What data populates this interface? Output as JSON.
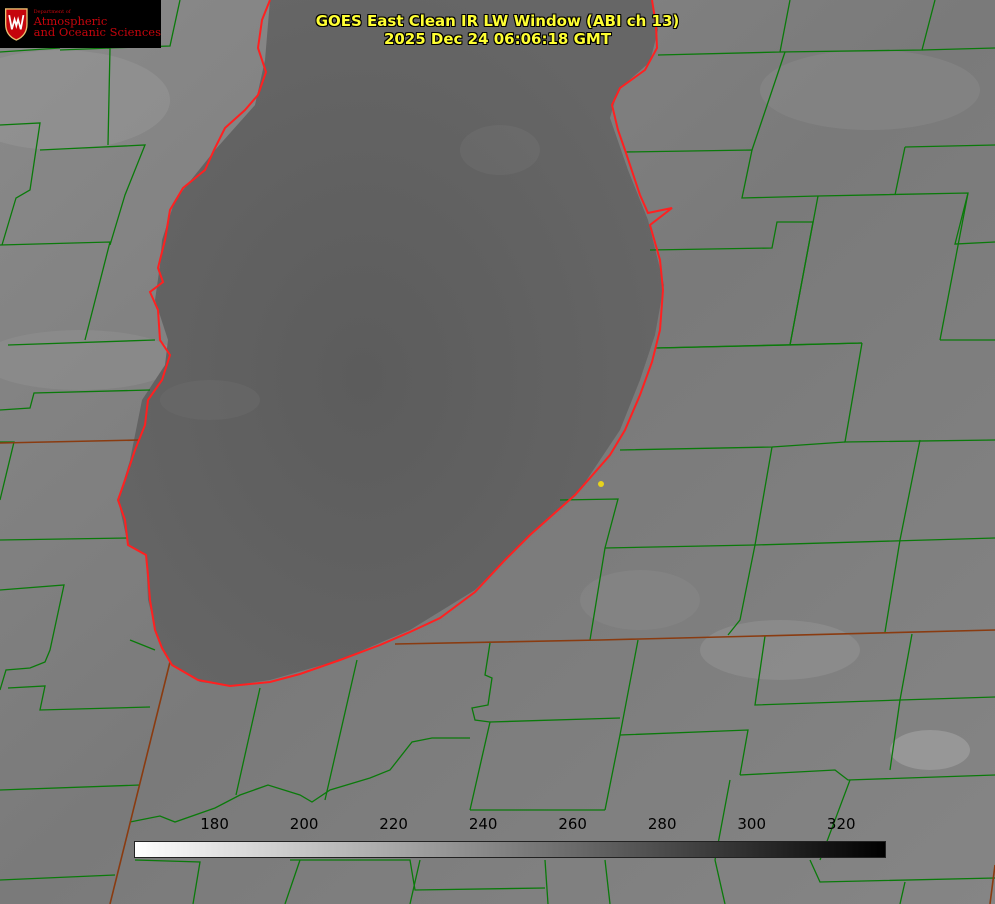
{
  "logo": {
    "department": "Department of",
    "line1": "Atmospheric",
    "line2": "and Oceanic Sciences",
    "color": "#c5050c",
    "seal_icon": "uw-crest-icon"
  },
  "title": {
    "line1": "GOES East Clean IR LW Window (ABI ch 13)",
    "line2": "2025 Dec 24 06:06:18 GMT",
    "color": "#ffff33"
  },
  "colorbar": {
    "ticks": [
      "180",
      "200",
      "220",
      "240",
      "260",
      "280",
      "300",
      "320"
    ],
    "tick_values": [
      180,
      200,
      220,
      240,
      260,
      280,
      300,
      320
    ],
    "min": 162,
    "max": 330
  },
  "overlay_colors": {
    "county_borders": "#0a7a0a",
    "state_borders": "#8a3b10",
    "coastline": "#ff2020",
    "marker": "#e6d31c"
  }
}
